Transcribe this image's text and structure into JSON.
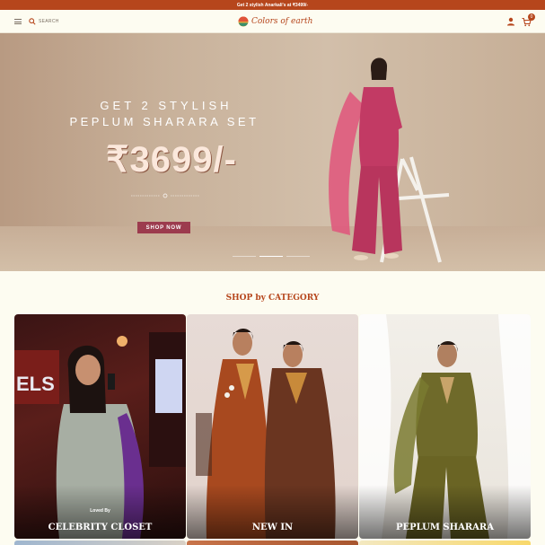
{
  "announcement": "Get 2 stylish Anarkali's at ₹3499/-",
  "header": {
    "search_label": "SEARCH",
    "logo_text": "Colors of earth",
    "cart_count": "0",
    "brand_color": "#b6461c"
  },
  "hero": {
    "line1": "GET 2 STYLISH",
    "line2": "PEPLUM SHARARA SET",
    "price": "₹3699/-",
    "cta": "SHOP NOW",
    "slides_total": 3,
    "active_slide": 2
  },
  "categories": {
    "title": "SHOP by CATEGORY",
    "items": [
      {
        "label": "CELEBRITY CLOSET",
        "sublabel": "Loved By"
      },
      {
        "label": "NEW IN"
      },
      {
        "label": "PEPLUM SHARARA"
      }
    ]
  }
}
